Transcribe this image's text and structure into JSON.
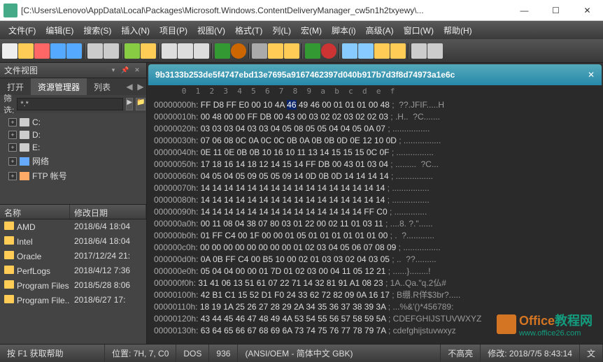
{
  "window": {
    "title": "[C:\\Users\\Lenovo\\AppData\\Local\\Packages\\Microsoft.Windows.ContentDeliveryManager_cw5n1h2txyewy\\..."
  },
  "menu": [
    "文件(F)",
    "编辑(E)",
    "搜索(S)",
    "插入(N)",
    "项目(P)",
    "视图(V)",
    "格式(T)",
    "列(L)",
    "宏(M)",
    "脚本(i)",
    "高级(A)",
    "窗口(W)",
    "帮助(H)"
  ],
  "sidebar": {
    "title": "文件视图",
    "tabs": [
      "打开",
      "资源管理器",
      "列表"
    ],
    "active_tab": 1,
    "filter_label": "筛选:",
    "filter_value": "*.*",
    "tree": [
      {
        "label": "C:",
        "type": "drive"
      },
      {
        "label": "D:",
        "type": "drive"
      },
      {
        "label": "E:",
        "type": "drive"
      },
      {
        "label": "网络",
        "type": "net"
      },
      {
        "label": "FTP 帐号",
        "type": "ftp"
      }
    ],
    "list_headers": [
      "名称",
      "修改日期"
    ],
    "list_rows": [
      {
        "name": "AMD",
        "date": "2018/6/4 18:04"
      },
      {
        "name": "Intel",
        "date": "2018/6/4 18:04"
      },
      {
        "name": "Oracle",
        "date": "2017/12/24 21:"
      },
      {
        "name": "PerfLogs",
        "date": "2018/4/12 7:36"
      },
      {
        "name": "Program Files",
        "date": "2018/5/28 8:06"
      },
      {
        "name": "Program File...",
        "date": "2018/6/27 17:"
      }
    ]
  },
  "editor": {
    "tab_name": "9b3133b253de5f4747ebd13e7695a9167462397d040b917b7d3f8d74973a1e6c",
    "ruler": "      0  1  2  3  4  5  6  7  8  9  a  b  c  d  e  f",
    "rows": [
      {
        "addr": "00000000h:",
        "hex": "FF D8 FF E0 00 10 4A 46 49 46 00 01 01 01 00 48",
        "sep": ";",
        "asc": "  ??.JFIF.....H",
        "sel": [
          7
        ],
        "hl": [
          0
        ]
      },
      {
        "addr": "00000010h:",
        "hex": "00 48 00 00 FF DB 00 43 00 03 02 02 03 02 02 03",
        "sep": ";",
        "asc": " .H..  ?C......."
      },
      {
        "addr": "00000020h:",
        "hex": "03 03 03 04 03 03 04 05 08 05 05 04 04 05 0A 07",
        "sep": ";",
        "asc": " ................"
      },
      {
        "addr": "00000030h:",
        "hex": "07 06 08 0C 0A 0C 0C 0B 0A 0B 0B 0D 0E 12 10 0D",
        "sep": ";",
        "asc": " ................"
      },
      {
        "addr": "00000040h:",
        "hex": "0E 11 0E 0B 0B 10 16 10 11 13 14 15 15 15 0C 0F",
        "sep": ";",
        "asc": " ................"
      },
      {
        "addr": "00000050h:",
        "hex": "17 18 16 14 18 12 14 15 14 FF DB 00 43 01 03 04",
        "sep": ";",
        "asc": " .........  ?C..."
      },
      {
        "addr": "00000060h:",
        "hex": "04 05 04 05 09 05 05 09 14 0D 0B 0D 14 14 14 14",
        "sep": ";",
        "asc": " ................"
      },
      {
        "addr": "00000070h:",
        "hex": "14 14 14 14 14 14 14 14 14 14 14 14 14 14 14 14",
        "sep": ";",
        "asc": " ................"
      },
      {
        "addr": "00000080h:",
        "hex": "14 14 14 14 14 14 14 14 14 14 14 14 14 14 14 14",
        "sep": ";",
        "asc": " ................"
      },
      {
        "addr": "00000090h:",
        "hex": "14 14 14 14 14 14 14 14 14 14 14 14 14 14 FF C0",
        "sep": ";",
        "asc": " ..............  "
      },
      {
        "addr": "000000a0h:",
        "hex": "00 11 08 04 38 07 80 03 01 22 00 02 11 01 03 11",
        "sep": ";",
        "asc": " ....8. ?.\"......"
      },
      {
        "addr": "000000b0h:",
        "hex": "01 FF C4 00 1F 00 00 01 05 01 01 01 01 01 01 00",
        "sep": ";",
        "asc": " .  ?............"
      },
      {
        "addr": "000000c0h:",
        "hex": "00 00 00 00 00 00 00 00 01 02 03 04 05 06 07 08 09",
        "sep": ";",
        "asc": " ................"
      },
      {
        "addr": "000000d0h:",
        "hex": "0A 0B FF C4 00 B5 10 00 02 01 03 03 02 04 03 05",
        "sep": ";",
        "asc": " ..  ??........."
      },
      {
        "addr": "000000e0h:",
        "hex": "05 04 04 00 00 01 7D 01 02 03 00 04 11 05 12 21",
        "sep": ";",
        "asc": " ......}........!"
      },
      {
        "addr": "000000f0h:",
        "hex": "31 41 06 13 51 61 07 22 71 14 32 81 91 A1 08 23",
        "sep": ";",
        "asc": " 1A..Qa.\"q.2仏#"
      },
      {
        "addr": "00000100h:",
        "hex": "42 B1 C1 15 52 D1 F0 24 33 62 72 82 09 0A 16 17",
        "sep": ";",
        "asc": " B绷.R佯$3br?....."
      },
      {
        "addr": "00000110h:",
        "hex": "18 19 1A 25 26 27 28 29 2A 34 35 36 37 38 39 3A",
        "sep": ";",
        "asc": " ...%&'()*456789:"
      },
      {
        "addr": "00000120h:",
        "hex": "43 44 45 46 47 48 49 4A 53 54 55 56 57 58 59 5A",
        "sep": ";",
        "asc": " CDEFGHIJSTUVWXYZ"
      },
      {
        "addr": "00000130h:",
        "hex": "63 64 65 66 67 68 69 6A 73 74 75 76 77 78 79 7A",
        "sep": ";",
        "asc": " cdefghijstuvwxyz"
      }
    ]
  },
  "statusbar": {
    "help": "按 F1 获取帮助",
    "pos_label": "位置:",
    "pos": "7H, 7, C0",
    "mode": "DOS",
    "codepage": "936",
    "encoding": "(ANSI/OEM - 简体中文 GBK)",
    "highlight": "不高亮",
    "modified_label": "修改:",
    "modified": "2018/7/5 8:43:14",
    "filetype": "文"
  },
  "watermark": {
    "t1": "Office",
    "t2": "教程网",
    "t3": "www.office26.com"
  }
}
